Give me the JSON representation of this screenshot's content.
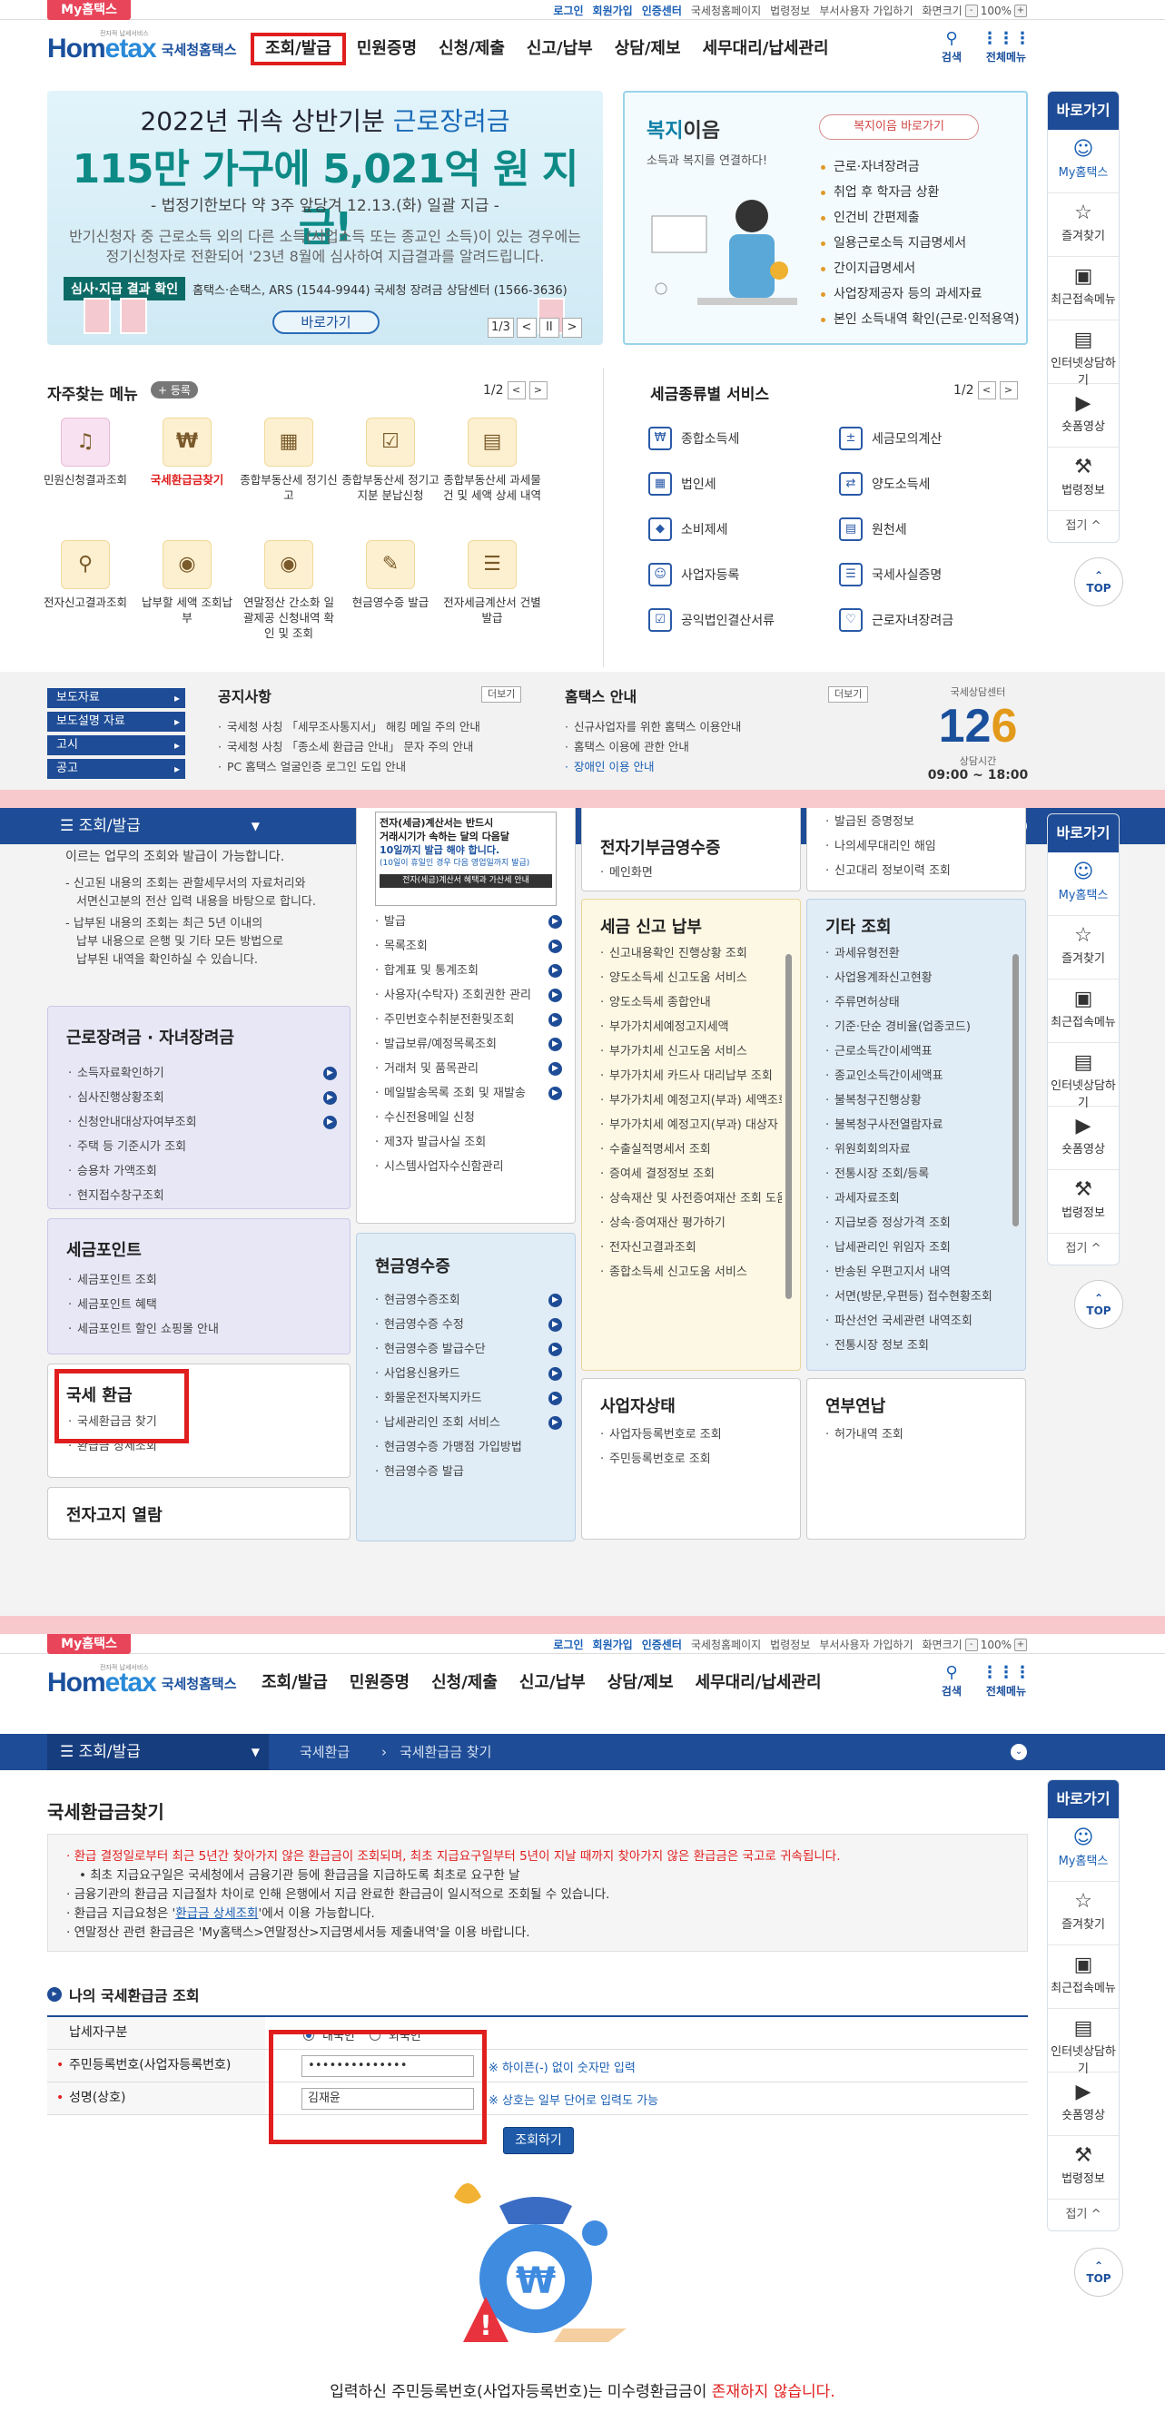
{
  "topbar": {
    "my_tab": "My홈택스",
    "login": "로그인",
    "signup": "회원가입",
    "cert_center": "인증센터",
    "nts_home": "국세청홈페이지",
    "law_info": "법령정보",
    "deputy_signup": "부서사용자 가입하기",
    "screen_size": "화면크기",
    "zoom_minus": "-",
    "zoom_value": "100%",
    "zoom_plus": "+"
  },
  "header": {
    "logo_tiny": "전자적 납세서비스",
    "logo_main_a": "Hom",
    "logo_main_b": "etax",
    "logo_sub": "국세청홈택스",
    "nav": [
      "조회/발급",
      "민원증명",
      "신청/제출",
      "신고/납부",
      "상담/제보",
      "세무대리/납세관리"
    ],
    "search": "검색",
    "all_menu": "전체메뉴"
  },
  "sidebar": {
    "title": "바로가기",
    "items": [
      "My홈택스",
      "즐겨찾기",
      "최근접속메뉴",
      "인터넷상담하기",
      "숏폼영상",
      "법령정보"
    ],
    "fold": "접기 ^",
    "top": "TOP"
  },
  "banner": {
    "line1_a": "2022년 귀속 상반기분 ",
    "line1_b": "근로장려금",
    "line2": "115만 가구에 5,021억 원 지급!",
    "line3": "- 법정기한보다 약 3주 앞당겨 12.13.(화) 일괄 지급 -",
    "line4a": "반기신청자 중 근로소득 외의 다른 소득(사업소득 또는 종교인 소득)이 있는 경우에는",
    "line4b": "정기신청자로 전환되어 '23년 8월에 심사하여 지급결과를 알려드립니다.",
    "strip_label": "심사·지급 결과 확인",
    "strip_text": "홈택스·손택스, ARS (1544-9944) 국세청 장려금 상담센터 (1566-3636)",
    "button": "바로가기",
    "pager_count": "1/3",
    "pager_prev": "<",
    "pager_pause": "II",
    "pager_next": ">"
  },
  "welfare": {
    "title_a": "복지",
    "title_b": "이음",
    "subtitle": "소득과 복지를 연결하다!",
    "button": "복지이음 바로가기",
    "items": [
      "근로·자녀장려금",
      "취업 후 학자금 상환",
      "인건비 간편제출",
      "일용근로소득 지급명세서",
      "간이지급명세서",
      "사업장제공자 등의 과세자료",
      "본인 소득내역 확인(근로·인적용역)"
    ]
  },
  "frequent": {
    "title": "자주찾는 메뉴",
    "register": "+ 등록",
    "page": "1/2",
    "prev": "<",
    "next": ">",
    "items": [
      "민원신청결과조회",
      "국세환급금찾기",
      "종합부동산세 정기신고",
      "종합부동산세 정기고지분 분납신청",
      "종합부동산세 과세물건 및 세액 상세 내역",
      "전자신고결과조회",
      "납부할 세액 조회납부",
      "연말정산 간소화 일괄제공 신청내역 확인 및 조회",
      "현금영수증 발급",
      "전자세금계산서 건별발급"
    ]
  },
  "taxservices": {
    "title": "세금종류별 서비스",
    "page": "1/2",
    "prev": "<",
    "next": ">",
    "items": [
      "종합소득세",
      "세금모의계산",
      "법인세",
      "양도소득세",
      "소비제세",
      "원천세",
      "사업자등록",
      "국세사실증명",
      "공익법인결산서류",
      "근로자녀장려금"
    ]
  },
  "notice": {
    "tabs": [
      "보도자료",
      "보도설명 자료",
      "고시",
      "공고"
    ],
    "notice_title": "공지사항",
    "more": "더보기",
    "notice_items": [
      "국세청 사칭 「세무조사통지서」 해킹 메일 주의 안내",
      "국세청 사칭 「종소세 환급금 안내」 문자 주의 안내",
      "PC 홈택스 얼굴인증 로그인 도입 안내"
    ],
    "hometax_title": "홈택스 안내",
    "hometax_items": [
      "신규사업자를 위한 홈택스 이용안내",
      "홈택스 이용에 관한 안내",
      "장애인 이용 안내"
    ],
    "call_brand": "국세상담센터",
    "call_num_a": "12",
    "call_num_b": "6",
    "call_label": "상담시간",
    "call_time": "09:00 ~ 18:00"
  },
  "section2": {
    "menu": "조회/발급",
    "left_top_1": "이르는 업무의 조회와 발급이 가능합니다.",
    "left_top_2": "- 신고된 내용의 조회는 관할세무서의 자료처리와",
    "left_top_3": "서면신고분의 전산 입력 내용을 바탕으로 합니다.",
    "left_top_4": "- 납부된 내용의 조회는 최근 5년 이내의",
    "left_top_5": "납부 내용으로 은행 및 기타 모든 방법으로",
    "left_top_6": "납부된 내역을 확인하실 수 있습니다.",
    "earned": {
      "title": "근로장려금 · 자녀장려금",
      "items": [
        "소득자료확인하기",
        "심사진행상황조회",
        "신청안내대상자여부조회",
        "주택 등 기준시가 조회",
        "승용차 가액조회",
        "현지접수창구조회"
      ]
    },
    "point": {
      "title": "세금포인트",
      "items": [
        "세금포인트 조회",
        "세금포인트 혜택",
        "세금포인트 할인 쇼핑몰 안내"
      ]
    },
    "refund": {
      "title": "국세 환급",
      "items": [
        "국세환급금 찾기",
        "환급금 상세조회"
      ]
    },
    "einvoice_notice_1": "전자(세금)계산서는 반드시",
    "einvoice_notice_2": "거래시기가 속하는 달의 다음달",
    "einvoice_notice_3": "10일까지 발급 해야 합니다.",
    "einvoice_notice_4": "(10일이 휴일인 경우 다음 영업일까지 발급)",
    "einvoice_notice_5": "전자(세금)계산서 혜택과 가산세 안내",
    "einvoice_items": [
      "발급",
      "목록조회",
      "합계표 및 통계조회",
      "사용자(수탁자) 조회권한 관리",
      "주민번호수취분전환및조회",
      "발급보류/예정목록조회",
      "거래처 및 품목관리",
      "메일발송목록 조회 및 재발송",
      "수신전용메일 신청",
      "제3자 발급사실 조회",
      "시스템사업자수신함관리"
    ],
    "cash": {
      "title": "현금영수증",
      "items": [
        "현금영수증조회",
        "현금영수증 수정",
        "현금영수증 발급수단",
        "사업용신용카드",
        "화물운전자복지카드",
        "납세관리인 조회 서비스",
        "현금영수증 가맹점 가입방법",
        "현금영수증 발급"
      ]
    },
    "notax": {
      "title": "전자고지 열람"
    },
    "ereceipt": {
      "title": "전자기부금영수증",
      "items": [
        "메인화면"
      ]
    },
    "report": {
      "title": "세금 신고 납부",
      "items": [
        "신고내용확인 진행상황 조회",
        "양도소득세 신고도움 서비스",
        "양도소득세 종합안내",
        "부가가치세예정고지세액",
        "부가가치세 신고도움 서비스",
        "부가가치세 카드사 대리납부 조회",
        "부가가치세 예정고지(부과) 세액조회",
        "부가가치세 예정고지(부과) 대상자 조회",
        "수출실적명세서 조회",
        "증여세 결정정보 조회",
        "상속재산 및 사전증여재산 조회 도움 서비스",
        "상속·증여재산 평가하기",
        "전자신고결과조회",
        "종합소득세 신고도움 서비스"
      ]
    },
    "topright": {
      "items": [
        "발급된 증명정보",
        "나의세무대리인 해임",
        "신고대리 정보이력 조회"
      ]
    },
    "other": {
      "title": "기타 조회",
      "items": [
        "과세유형전환",
        "사업용계좌신고현황",
        "주류면허상태",
        "기준·단순 경비율(업종코드)",
        "근로소득간이세액표",
        "종교인소득간이세액표",
        "불복청구진행상황",
        "불복청구사전열람자료",
        "위원회회의자료",
        "전통시장 조회/등록",
        "과세자료조회",
        "지급보증 정상가격 조회",
        "납세관리인 위임자 조회",
        "반송된 우편고지서 내역",
        "서면(방문,우편등) 접수현황조회",
        "파산선언 국세관련 내역조회",
        "전통시장 정보 조회"
      ]
    },
    "bizstatus": {
      "title": "사업자상태",
      "items": [
        "사업자등록번호로 조회",
        "주민등록번호로 조회"
      ]
    },
    "pension": {
      "title": "연부연납",
      "items": [
        "허가내역 조회"
      ]
    }
  },
  "section3": {
    "crumb_menu": "조회/발급",
    "crumb_1": "국세환급",
    "crumb_2": "국세환급금 찾기",
    "page_title": "국세환급금찾기",
    "info_1": "환급 결정일로부터 최근 5년간 찾아가지 않은 환급금이 조회되며, 최초 지급요구일부터 5년이 지날 때까지 찾아가지 않은 환급금은 국고로 귀속됩니다.",
    "info_2": "• 최초 지급요구일은 국세청에서 금융기관 등에 환급금을 지급하도록 최초로 요구한 날",
    "info_3": "금융기관의 환급금 지급절차 차이로 인해 은행에서 지급 완료한 환급금이 일시적으로 조회될 수 있습니다.",
    "info_4a": "환급금 지급요청은 '",
    "info_4b": "환급금 상세조회",
    "info_4c": "'에서 이용 가능합니다.",
    "info_5": "연말정산 관련 환급금은 'My홈택스>연말정산>지급명세서등 제출내역'을 이용 바랍니다.",
    "form_title": "나의 국세환급금 조회",
    "row1_label": "납세자구분",
    "radio_1": "내국인",
    "radio_2": "외국인",
    "row2_label": "주민등록번호(사업자등록번호)",
    "row2_value": "••••••••••••••",
    "row2_hint": "※ 하이픈(-) 없이 숫자만 입력",
    "row3_label": "성명(상호)",
    "row3_value": "김재윤",
    "row3_hint": "※ 상호는 일부 단어로 입력도 가능",
    "query_button": "조회하기",
    "result_a": "입력하신 주민등록번호(사업자등록번호)는 미수령환급금이 ",
    "result_b": "존재하지 않습니다."
  }
}
